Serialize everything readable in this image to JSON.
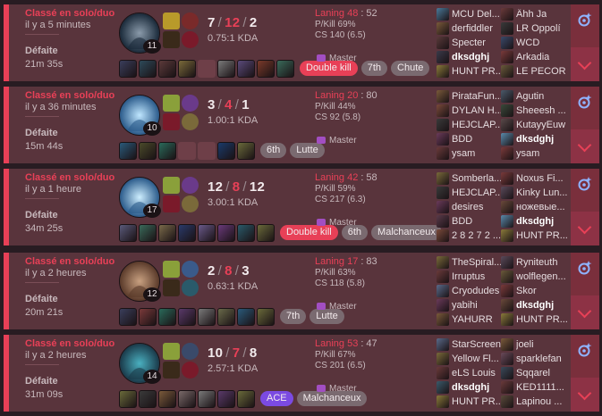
{
  "matches": [
    {
      "queue": "Classé en solo/duo",
      "ago": "il y a 5 minutes",
      "result": "Défaite",
      "duration": "21m 35s",
      "level": "11",
      "kills": "7",
      "deaths": "12",
      "assists": "2",
      "kda": "0.75:1 KDA",
      "laning_label": "Laning",
      "laning_a": "48",
      "laning_sep": ":",
      "laning_b": "52",
      "pkill": "P/Kill 69%",
      "cs": "CS 140 (6.5)",
      "tier": "Master",
      "items": [
        "#3a3e5c",
        "#2e4a5a",
        "#5c3a3a",
        "#7a6a3a",
        "empty",
        "#7a7a7a",
        "#5a4a7a",
        "#7a3a2a",
        "#3a6a5a"
      ],
      "badges": [
        {
          "t": "Double kill",
          "k": "red"
        },
        {
          "t": "7th",
          "k": ""
        },
        {
          "t": "Chute",
          "k": ""
        }
      ],
      "team1": [
        {
          "n": "MCU Del...",
          "c": "#4a7a9a"
        },
        {
          "n": "derfiddler",
          "c": "#7a5a3a"
        },
        {
          "n": "Specter",
          "c": "#5a3a3a"
        },
        {
          "n": "dksdghj",
          "c": "#3a3a4a",
          "me": true
        },
        {
          "n": "HUNT PR...",
          "c": "#8a7a3a"
        }
      ],
      "team2": [
        {
          "n": "Ähh Ja",
          "c": "#6a3a3a"
        },
        {
          "n": "LR Oppolí",
          "c": "#3a3a3a"
        },
        {
          "n": "WCD",
          "c": "#3a4a6a"
        },
        {
          "n": "Arkadia",
          "c": "#7a3a3a"
        },
        {
          "n": "LE PECOR",
          "c": "#6a5a3a"
        }
      ]
    },
    {
      "queue": "Classé en solo/duo",
      "ago": "il y a 36 minutes",
      "result": "Défaite",
      "duration": "15m 44s",
      "level": "10",
      "kills": "3",
      "deaths": "4",
      "assists": "1",
      "kda": "1.00:1 KDA",
      "laning_label": "Laning",
      "laning_a": "20",
      "laning_sep": ":",
      "laning_b": "80",
      "pkill": "P/Kill 44%",
      "cs": "CS 92 (5.8)",
      "tier": "Master",
      "items": [
        "#2a5a7a",
        "#4a4a2a",
        "#2a6a5a",
        "empty",
        "empty",
        "#1a3a6a",
        "#6a6a3a"
      ],
      "badges": [
        {
          "t": "6th",
          "k": ""
        },
        {
          "t": "Lutte",
          "k": ""
        }
      ],
      "team1": [
        {
          "n": "PirataFun...",
          "c": "#7a5a3a"
        },
        {
          "n": "DYLAN H...",
          "c": "#7a4a3a"
        },
        {
          "n": "HEJCLAP...",
          "c": "#3a3a3a"
        },
        {
          "n": "BDD",
          "c": "#6a3a5a"
        },
        {
          "n": "ysam",
          "c": "#6a3a3a"
        }
      ],
      "team2": [
        {
          "n": "Agutin",
          "c": "#4a5a6a"
        },
        {
          "n": "Sheeesh ...",
          "c": "#3a4a3a"
        },
        {
          "n": "KutayyEuw",
          "c": "#5a4a4a"
        },
        {
          "n": "dksdghj",
          "c": "#5a8aaa",
          "me": true
        },
        {
          "n": "ysam",
          "c": "#7a3a3a"
        }
      ]
    },
    {
      "queue": "Classé en solo/duo",
      "ago": "il y a 1 heure",
      "result": "Défaite",
      "duration": "34m 25s",
      "level": "17",
      "kills": "12",
      "deaths": "8",
      "assists": "12",
      "kda": "3.00:1 KDA",
      "laning_label": "Laning",
      "laning_a": "42",
      "laning_sep": ":",
      "laning_b": "58",
      "pkill": "P/Kill 59%",
      "cs": "CS 217 (6.3)",
      "tier": "Master",
      "items": [
        "#5a5a7a",
        "#3a6a5a",
        "#7a6a4a",
        "#2a3a6a",
        "#6a5a8a",
        "#6a3a7a",
        "#2a5a6a",
        "#6a6a3a"
      ],
      "badges": [
        {
          "t": "Double kill",
          "k": "red"
        },
        {
          "t": "6th",
          "k": ""
        },
        {
          "t": "Malchanceux",
          "k": ""
        }
      ],
      "team1": [
        {
          "n": "Somberla...",
          "c": "#7a6a3a"
        },
        {
          "n": "HEJCLAP...",
          "c": "#3a3a3a"
        },
        {
          "n": "desires",
          "c": "#6a3a5a"
        },
        {
          "n": "BDD",
          "c": "#5a3a4a"
        },
        {
          "n": "2 8 2 7 2 ...",
          "c": "#7a4a3a"
        }
      ],
      "team2": [
        {
          "n": "Noxus Fi...",
          "c": "#7a3a3a"
        },
        {
          "n": "Kinky Lun...",
          "c": "#5a4a5a"
        },
        {
          "n": "ножевые...",
          "c": "#6a4a3a"
        },
        {
          "n": "dksdghj",
          "c": "#5a8aaa",
          "me": true
        },
        {
          "n": "HUNT PR...",
          "c": "#8a7a3a"
        }
      ]
    },
    {
      "queue": "Classé en solo/duo",
      "ago": "il y a 2 heures",
      "result": "Défaite",
      "duration": "20m 21s",
      "level": "12",
      "kills": "2",
      "deaths": "8",
      "assists": "3",
      "kda": "0.63:1 KDA",
      "laning_label": "Laning",
      "laning_a": "17",
      "laning_sep": ":",
      "laning_b": "83",
      "pkill": "P/Kill 63%",
      "cs": "CS 118 (5.8)",
      "tier": "Master",
      "items": [
        "#3a3e5c",
        "#7a3a3a",
        "#2a6a5a",
        "#5a3a6a",
        "#7a7a7a",
        "#6a6a4a",
        "#2a5a7a",
        "#6a6a3a"
      ],
      "badges": [
        {
          "t": "7th",
          "k": ""
        },
        {
          "t": "Lutte",
          "k": ""
        }
      ],
      "team1": [
        {
          "n": "TheSpiral...",
          "c": "#7a6a3a"
        },
        {
          "n": "Irruptus",
          "c": "#6a3a3a"
        },
        {
          "n": "Cryodudes",
          "c": "#5a6a8a"
        },
        {
          "n": "yabihi",
          "c": "#6a3a5a"
        },
        {
          "n": "YAHURR",
          "c": "#7a5a3a"
        }
      ],
      "team2": [
        {
          "n": "Ryniteuth",
          "c": "#5a4a5a"
        },
        {
          "n": "wolflegen...",
          "c": "#6a5a3a"
        },
        {
          "n": "Skor",
          "c": "#7a3a3a"
        },
        {
          "n": "dksdghj",
          "c": "#6a4a3a",
          "me": true
        },
        {
          "n": "HUNT PR...",
          "c": "#8a7a3a"
        }
      ]
    },
    {
      "queue": "Classé en solo/duo",
      "ago": "il y a 2 heures",
      "result": "Défaite",
      "duration": "31m 09s",
      "level": "14",
      "kills": "10",
      "deaths": "7",
      "assists": "8",
      "kda": "2.57:1 KDA",
      "laning_label": "Laning",
      "laning_a": "53",
      "laning_sep": ":",
      "laning_b": "47",
      "pkill": "P/Kill 67%",
      "cs": "CS 201 (6.5)",
      "tier": "Master",
      "items": [
        "#6a6a3a",
        "#3a3a3a",
        "#7a5a3a",
        "#7a6a6a",
        "#7a7a7a",
        "#5a3a6a",
        "#6a6a3a"
      ],
      "badges": [
        {
          "t": "ACE",
          "k": "purple"
        },
        {
          "t": "Malchanceux",
          "k": ""
        }
      ],
      "team1": [
        {
          "n": "StarScreen",
          "c": "#5a6a8a"
        },
        {
          "n": "Yellow Fl...",
          "c": "#7a6a3a"
        },
        {
          "n": "eLS Louis",
          "c": "#6a3a3a"
        },
        {
          "n": "dksdghj",
          "c": "#3a5a6a",
          "me": true
        },
        {
          "n": "HUNT PR...",
          "c": "#8a7a3a"
        }
      ],
      "team2": [
        {
          "n": "joeli",
          "c": "#7a5a3a"
        },
        {
          "n": "sparklefan",
          "c": "#6a4a5a"
        },
        {
          "n": "Sqqarel",
          "c": "#3a4a5a"
        },
        {
          "n": "KED1111...",
          "c": "#6a3a3a"
        },
        {
          "n": "Lapinou ...",
          "c": "#5a4a3a"
        }
      ]
    }
  ]
}
